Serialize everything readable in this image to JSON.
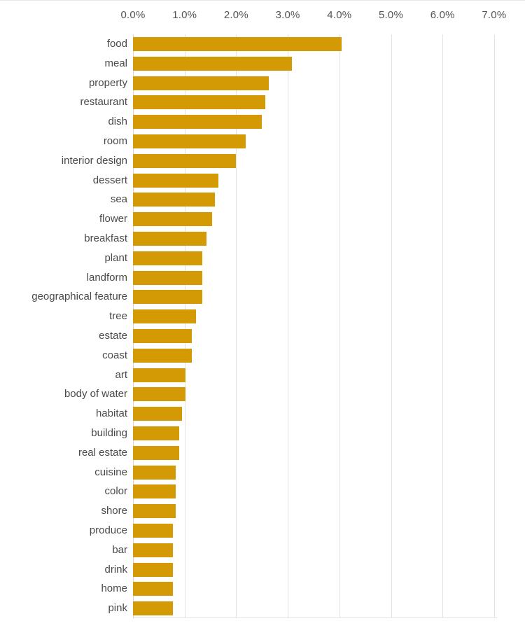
{
  "chart_data": {
    "type": "bar",
    "orientation": "horizontal",
    "title": "",
    "subtitle": "",
    "xlabel": "",
    "ylabel": "",
    "xlim": [
      0.0,
      7.3
    ],
    "ylim": null,
    "grid": true,
    "legend": null,
    "legend_position": "none",
    "bar_color": "#d49a05",
    "gridline_color": "#e3e3e3",
    "tick_label_color": "#555555",
    "category_label_color": "#4a4a4a",
    "x_ticks": [
      0.0,
      1.0,
      2.0,
      3.0,
      4.0,
      5.0,
      6.0,
      7.0
    ],
    "x_tick_labels": [
      "0.0%",
      "1.0%",
      "2.0%",
      "3.0%",
      "4.0%",
      "5.0%",
      "6.0%",
      "7.0%"
    ],
    "value_unit": "%",
    "categories": [
      "food",
      "meal",
      "property",
      "restaurant",
      "dish",
      "room",
      "interior design",
      "dessert",
      "sea",
      "flower",
      "breakfast",
      "plant",
      "landform",
      "geographical feature",
      "tree",
      "estate",
      "coast",
      "art",
      "body of water",
      "habitat",
      "building",
      "real estate",
      "cuisine",
      "color",
      "shore",
      "produce",
      "bar",
      "drink",
      "home",
      "pink"
    ],
    "values": [
      4.05,
      3.08,
      2.63,
      2.57,
      2.5,
      2.18,
      1.99,
      1.66,
      1.59,
      1.53,
      1.42,
      1.35,
      1.35,
      1.35,
      1.22,
      1.14,
      1.14,
      1.02,
      1.02,
      0.95,
      0.9,
      0.9,
      0.83,
      0.83,
      0.83,
      0.77,
      0.77,
      0.77,
      0.77,
      0.77
    ]
  }
}
